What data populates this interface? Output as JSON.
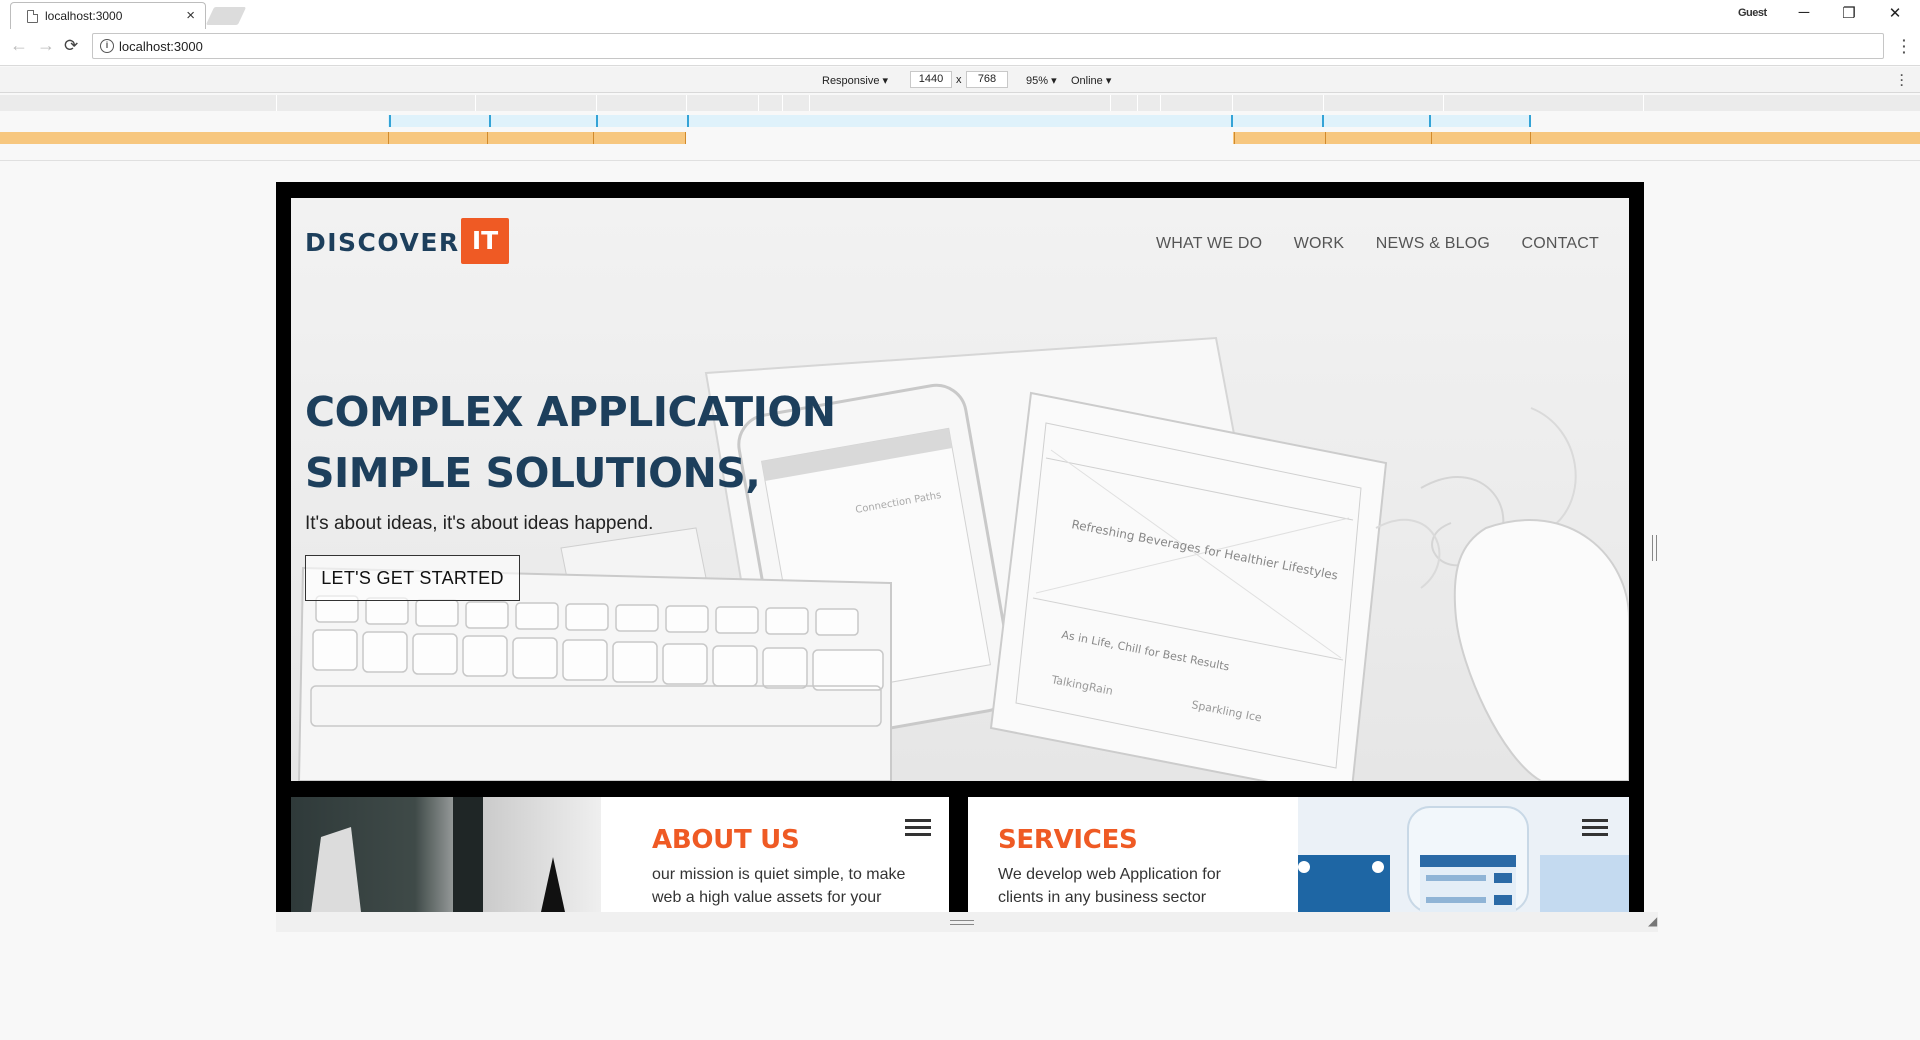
{
  "browser": {
    "tab_title": "localhost:3000",
    "tab_close": "×",
    "profile": "Guest",
    "window_controls": [
      "─",
      "❐",
      "✕"
    ],
    "url": "localhost:3000",
    "back_icon": "←",
    "forward_icon": "→",
    "reload_icon": "⟳"
  },
  "devtools": {
    "device": "Responsive ▾",
    "width": "1440",
    "separator": "x",
    "height": "768",
    "zoom": "95% ▾",
    "network": "Online ▾"
  },
  "site": {
    "logo_text": "DISCOVER",
    "logo_badge": "IT",
    "nav": [
      "WHAT WE DO",
      "WORK",
      "NEWS & BLOG",
      "CONTACT"
    ],
    "headline_line1": "COMPLEX APPLICATION",
    "headline_line2": "SIMPLE SOLUTIONS,",
    "subline": "It's about ideas, it's about ideas happend.",
    "cta": "LET'S GET STARTED",
    "about": {
      "title": "ABOUT US",
      "text_line1": "our mission is quiet simple, to make",
      "text_line2": "web a high value assets for your"
    },
    "services": {
      "title": "SERVICES",
      "text_line1": "We develop web Application for",
      "text_line2": "clients in any business sector"
    }
  },
  "colors": {
    "accent": "#ef5a24",
    "navy": "#1d3f5c",
    "media_query_max": "#dff2fb",
    "media_query_range": "#f7c77f"
  }
}
